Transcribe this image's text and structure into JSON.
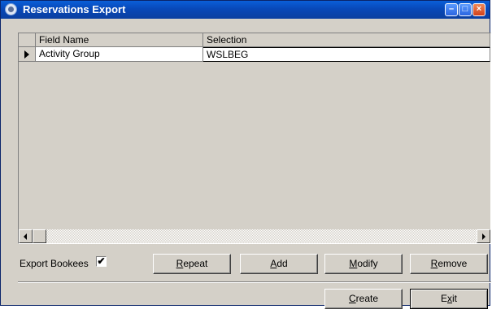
{
  "window": {
    "title": "Reservations Export",
    "icon": "app-icon",
    "controls": [
      "minimize-icon",
      "maximize-icon",
      "close-icon"
    ]
  },
  "grid": {
    "columns": [
      "Field Name",
      "Selection"
    ],
    "rows": [
      {
        "field_name": "Activity Group",
        "selection": "WSLBEG",
        "current": true
      }
    ]
  },
  "options": {
    "export_bookees_label": "Export Bookees",
    "export_bookees_checked": true,
    "check_mark": "✔"
  },
  "buttons": {
    "repeat": {
      "mnemonic": "R",
      "rest": "epeat"
    },
    "add": {
      "mnemonic": "A",
      "rest": "dd"
    },
    "modify": {
      "mnemonic": "M",
      "rest": "odify"
    },
    "remove": {
      "mnemonic": "R",
      "rest": "emove"
    },
    "create": {
      "mnemonic": "C",
      "rest": "reate"
    },
    "exit": {
      "pre": "E",
      "mnemonic": "x",
      "rest": "it"
    }
  }
}
